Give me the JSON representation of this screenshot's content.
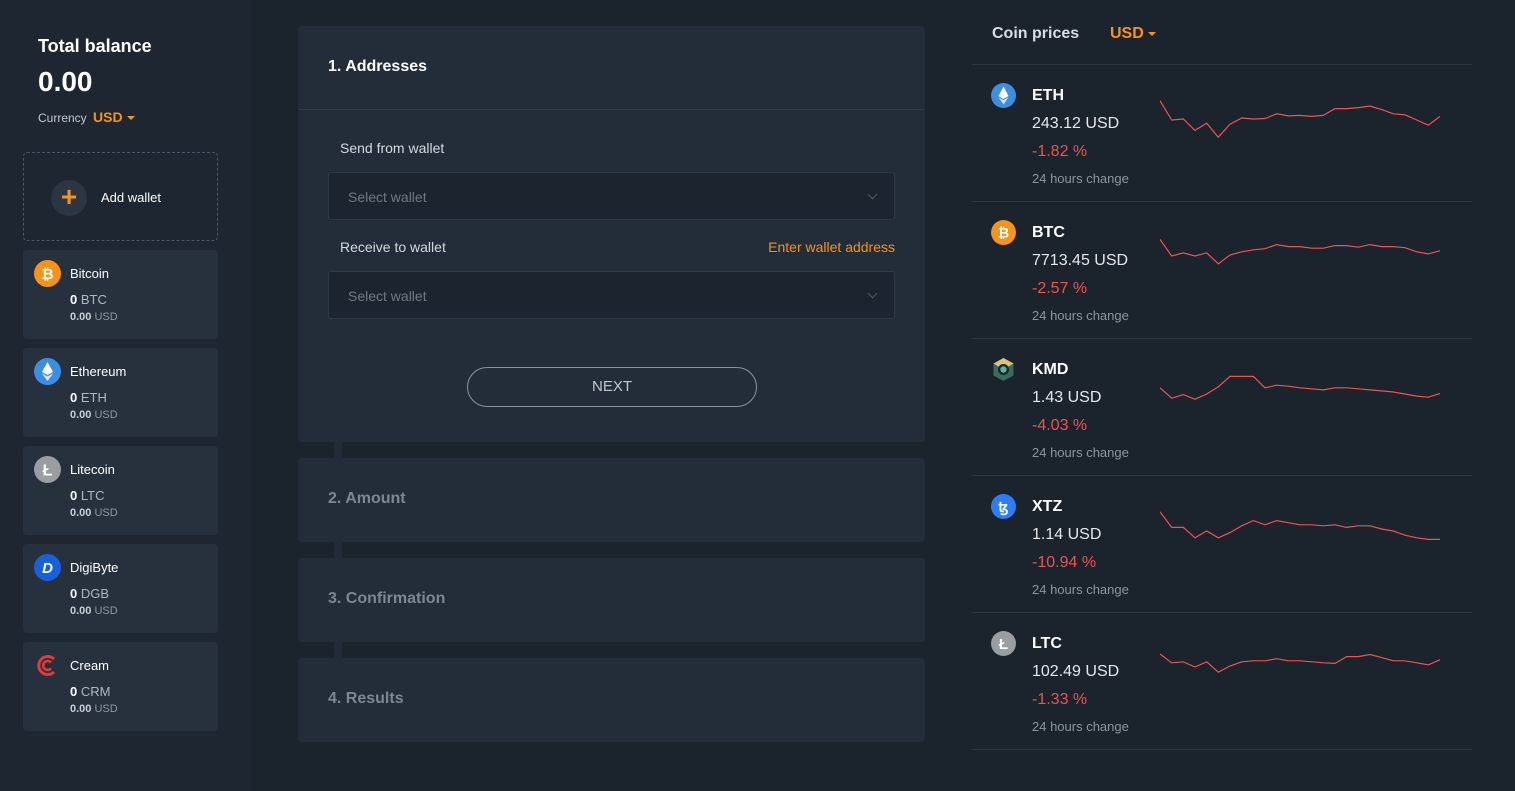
{
  "balance": {
    "title": "Total balance",
    "value": "0.00",
    "currency_label": "Currency",
    "currency": "USD"
  },
  "add_wallet": {
    "label": "Add wallet",
    "icon": "plus-icon"
  },
  "wallets": [
    {
      "name": "Bitcoin",
      "amount": "0",
      "symbol": "BTC",
      "usd": "0.00",
      "usd_label": "USD",
      "icon": "bitcoin-icon",
      "color": "#f7931a"
    },
    {
      "name": "Ethereum",
      "amount": "0",
      "symbol": "ETH",
      "usd": "0.00",
      "usd_label": "USD",
      "icon": "ethereum-icon",
      "color": "#3c8fe0"
    },
    {
      "name": "Litecoin",
      "amount": "0",
      "symbol": "LTC",
      "usd": "0.00",
      "usd_label": "USD",
      "icon": "litecoin-icon",
      "color": "#9a9da2"
    },
    {
      "name": "DigiByte",
      "amount": "0",
      "symbol": "DGB",
      "usd": "0.00",
      "usd_label": "USD",
      "icon": "digibyte-icon",
      "color": "#1760d8"
    },
    {
      "name": "Cream",
      "amount": "0",
      "symbol": "CRM",
      "usd": "0.00",
      "usd_label": "USD",
      "icon": "cream-icon",
      "color": "#e03a3a"
    }
  ],
  "steps": {
    "step1": {
      "title": "1. Addresses",
      "send_label": "Send from wallet",
      "send_placeholder": "Select wallet",
      "receive_label": "Receive to wallet",
      "enter_address_link": "Enter wallet address",
      "receive_placeholder": "Select wallet",
      "next_label": "NEXT"
    },
    "step2": {
      "title": "2. Amount"
    },
    "step3": {
      "title": "3. Confirmation"
    },
    "step4": {
      "title": "4. Results"
    }
  },
  "prices": {
    "title": "Coin prices",
    "currency": "USD",
    "accent": "#f7931a",
    "negative_color": "#ef5350",
    "coins": [
      {
        "symbol": "ETH",
        "price": "243.12 USD",
        "change": "-1.82 %",
        "sub": "24 hours change",
        "icon": "ethereum-icon",
        "trend": [
          85,
          48,
          50,
          28,
          42,
          15,
          40,
          52,
          50,
          51,
          60,
          56,
          57,
          55,
          57,
          70,
          70,
          72,
          75,
          68,
          60,
          58,
          48,
          38,
          55
        ]
      },
      {
        "symbol": "BTC",
        "price": "7713.45 USD",
        "change": "-2.57 %",
        "sub": "24 hours change",
        "icon": "bitcoin-icon",
        "trend": [
          82,
          50,
          56,
          50,
          56,
          35,
          52,
          58,
          62,
          64,
          72,
          68,
          68,
          65,
          65,
          70,
          70,
          67,
          72,
          68,
          68,
          66,
          58,
          54,
          60
        ]
      },
      {
        "symbol": "KMD",
        "price": "1.43 USD",
        "change": "-4.03 %",
        "sub": "24 hours change",
        "icon": "komodo-icon",
        "trend": [
          60,
          40,
          47,
          38,
          48,
          62,
          82,
          82,
          82,
          60,
          65,
          63,
          60,
          58,
          56,
          60,
          60,
          58,
          56,
          54,
          52,
          48,
          44,
          42,
          49
        ]
      },
      {
        "symbol": "XTZ",
        "price": "1.14 USD",
        "change": "-10.94 %",
        "sub": "24 hours change",
        "icon": "tezos-icon",
        "trend": [
          85,
          55,
          55,
          35,
          48,
          35,
          45,
          58,
          68,
          60,
          68,
          64,
          60,
          60,
          58,
          60,
          55,
          58,
          58,
          52,
          48,
          40,
          35,
          32,
          32
        ]
      },
      {
        "symbol": "LTC",
        "price": "102.49 USD",
        "change": "-1.33 %",
        "sub": "24 hours change",
        "icon": "litecoin-icon",
        "trend": [
          75,
          58,
          60,
          50,
          60,
          40,
          52,
          60,
          62,
          62,
          66,
          62,
          62,
          60,
          58,
          57,
          70,
          70,
          74,
          68,
          62,
          62,
          58,
          54,
          64
        ]
      }
    ]
  }
}
